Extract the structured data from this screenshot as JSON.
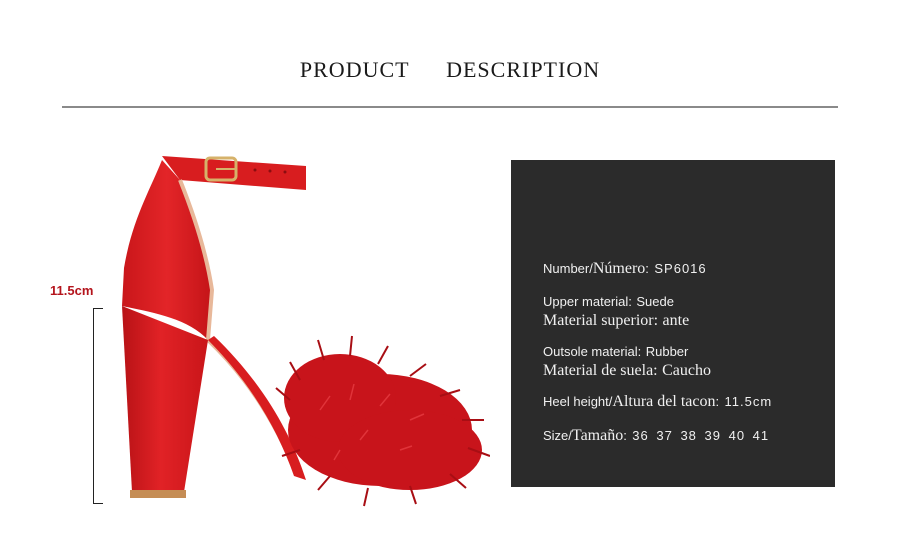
{
  "header": {
    "word1": "PRODUCT",
    "word2": "DESCRIPTION"
  },
  "measurement": {
    "heel_height_label": "11.5cm"
  },
  "colors": {
    "shoe": "#d81d1f",
    "panel": "#2b2b2b",
    "label_red": "#b4141c"
  },
  "specs": {
    "number": {
      "en": "Number/",
      "es": "Número",
      "sep": ":",
      "value": "SP6016"
    },
    "upper": {
      "en": "Upper material:",
      "en_value": "Suede",
      "es": "Material superior:",
      "es_value": "ante"
    },
    "outsole": {
      "en": "Outsole material:",
      "en_value": "Rubber",
      "es": "Material de suela:",
      "es_value": "Caucho"
    },
    "heel": {
      "en": "Heel height/",
      "es": "Altura del tacon",
      "sep": ":",
      "value": "11.5cm"
    },
    "size": {
      "en": "Size/",
      "es": "Tamaño",
      "sep": ":",
      "value": "36 37 38 39 40 41"
    }
  }
}
